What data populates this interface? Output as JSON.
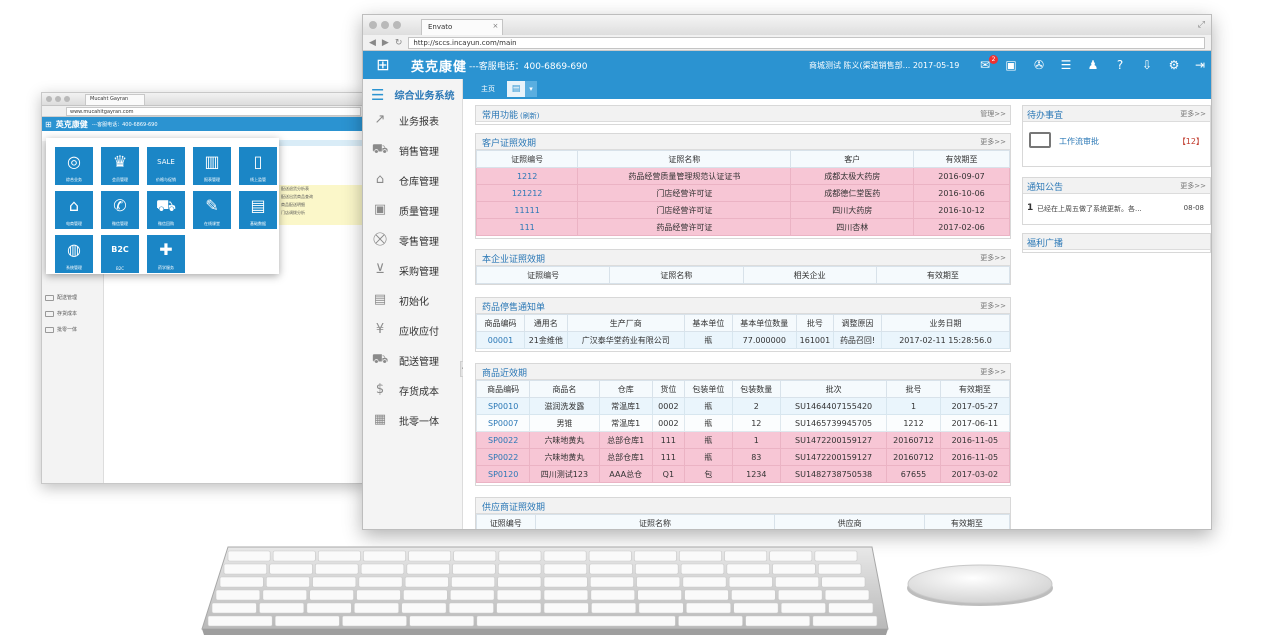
{
  "back_window": {
    "tab_title": "Mucaht Gayran",
    "url": "www.mucahitgayran.com",
    "logo": "英克康健",
    "phone": "---客服电话：400-6869-690",
    "sidebar": [
      "配送管理",
      "存货成本",
      "批零一体"
    ],
    "yellow_rows": [
      "配送退货分析表",
      "配送出货商品查询",
      "商品配送明细",
      "门店调拨分析"
    ],
    "tiles": [
      {
        "label": "综合业务",
        "icon": "globe-icon",
        "glyph": "◎"
      },
      {
        "label": "会员管理",
        "icon": "crown-icon",
        "glyph": "♛"
      },
      {
        "label": "价格与促销",
        "icon": "sale-icon",
        "glyph": "SALE"
      },
      {
        "label": "报表管理",
        "icon": "bar-chart-icon",
        "glyph": "▥"
      },
      {
        "label": "线上监管",
        "icon": "mobile-icon",
        "glyph": "▯"
      },
      {
        "label": "电商管理",
        "icon": "shop-icon",
        "glyph": "⌂"
      },
      {
        "label": "微信管理",
        "icon": "phone-chat-icon",
        "glyph": "✆"
      },
      {
        "label": "微信回购",
        "icon": "cart-icon",
        "glyph": "⛟"
      },
      {
        "label": "在线课堂",
        "icon": "graduation-cap-icon",
        "glyph": "✎"
      },
      {
        "label": "基础数据",
        "icon": "document-icon",
        "glyph": "▤"
      },
      {
        "label": "系统管理",
        "icon": "globe-icon",
        "glyph": "◍"
      },
      {
        "label": "B2C",
        "icon": "b2c-icon",
        "glyph": "B2C"
      },
      {
        "label": "药学服务",
        "icon": "medical-kit-icon",
        "glyph": "✚"
      }
    ]
  },
  "front_window": {
    "tab_title": "Envato",
    "url": "http://sccs.incayun.com/main",
    "app": {
      "logo": "英克康健",
      "phone": "---客服电话：400-6869-690",
      "user_info": "商城测试  陈义(渠道销售部...   2017-05-19",
      "message_badge": "2"
    },
    "toolbar_icons": [
      "message-icon",
      "qr-code-icon",
      "globe-icon",
      "list-icon",
      "user-tree-icon",
      "help-icon",
      "download-icon",
      "gear-icon",
      "logout-icon"
    ],
    "sidebar": {
      "title": "综合业务系统",
      "items": [
        {
          "label": "业务报表",
          "icon": "chart-icon",
          "glyph": "↗"
        },
        {
          "label": "销售管理",
          "icon": "truck-icon",
          "glyph": "⛟"
        },
        {
          "label": "仓库管理",
          "icon": "warehouse-icon",
          "glyph": "⌂"
        },
        {
          "label": "质量管理",
          "icon": "quality-box-icon",
          "glyph": "▣"
        },
        {
          "label": "零售管理",
          "icon": "cart-icon",
          "glyph": "⛒"
        },
        {
          "label": "采购管理",
          "icon": "basket-icon",
          "glyph": "⊻"
        },
        {
          "label": "初始化",
          "icon": "init-icon",
          "glyph": "▤"
        },
        {
          "label": "应收应付",
          "icon": "hand-money-icon",
          "glyph": "¥"
        },
        {
          "label": "配送管理",
          "icon": "van-icon",
          "glyph": "⛟"
        },
        {
          "label": "存货成本",
          "icon": "money-bag-icon",
          "glyph": "$"
        },
        {
          "label": "批零一体",
          "icon": "pos-icon",
          "glyph": "▦"
        }
      ]
    },
    "tabs": {
      "home": "主页"
    },
    "panels": {
      "common": {
        "title": "常用功能",
        "refresh": "(刷新)",
        "action": "管理>>"
      },
      "customer_license": {
        "title": "客户证照效期",
        "more": "更多>>",
        "headers": [
          "证照编号",
          "证照名称",
          "客户",
          "有效期至"
        ],
        "rows": [
          [
            "1212",
            "药品经营质量管理规范认证证书",
            "成都太极大药房",
            "2016-09-07"
          ],
          [
            "121212",
            "门店经营许可证",
            "成都德仁堂医药",
            "2016-10-06"
          ],
          [
            "11111",
            "门店经营许可证",
            "四川大药房",
            "2016-10-12"
          ],
          [
            "111",
            "药品经营许可证",
            "四川杏林",
            "2017-02-06"
          ]
        ]
      },
      "company_license": {
        "title": "本企业证照效期",
        "more": "更多>>",
        "headers": [
          "证照编号",
          "证照名称",
          "相关企业",
          "有效期至"
        ]
      },
      "drug_stop": {
        "title": "药品停售通知单",
        "more": "更多>>",
        "headers": [
          "商品编码",
          "通用名",
          "生产厂商",
          "基本单位",
          "基本单位数量",
          "批号",
          "调整原因",
          "业务日期"
        ],
        "rows": [
          [
            "00001",
            "21金维他",
            "广汉泰华堂药业有限公司",
            "瓶",
            "77.000000",
            "161001",
            "药品召回!",
            "2017-02-11 15:28:56.0"
          ]
        ]
      },
      "near_expiry": {
        "title": "商品近效期",
        "more": "更多>>",
        "headers": [
          "商品编码",
          "商品名",
          "仓库",
          "货位",
          "包装单位",
          "包装数量",
          "批次",
          "批号",
          "有效期至"
        ],
        "rows": [
          [
            "SP0010",
            "滋润洗发露",
            "常温库1",
            "0002",
            "瓶",
            "2",
            "SU1464407155420",
            "1",
            "2017-05-27"
          ],
          [
            "SP0007",
            "男锥",
            "常温库1",
            "0002",
            "瓶",
            "12",
            "SU1465739945705",
            "1212",
            "2017-06-11"
          ],
          [
            "SP0022",
            "六味地黄丸",
            "总部仓库1",
            "111",
            "瓶",
            "1",
            "SU1472200159127",
            "20160712",
            "2016-11-05"
          ],
          [
            "SP0022",
            "六味地黄丸",
            "总部仓库1",
            "111",
            "瓶",
            "83",
            "SU1472200159127",
            "20160712",
            "2016-11-05"
          ],
          [
            "SP0120",
            "四川测试123",
            "AAA总仓",
            "Q1",
            "包",
            "1234",
            "SU1482738750538",
            "67655",
            "2017-03-02"
          ]
        ]
      },
      "supplier_license": {
        "title": "供应商证照效期",
        "headers": [
          "证照编号",
          "证照名称",
          "供应商",
          "有效期至"
        ]
      }
    },
    "right": {
      "todo": {
        "title": "待办事宜",
        "more": "更多>>",
        "item": "工作流审批",
        "count": "【12】"
      },
      "notice": {
        "title": "通知公告",
        "more": "更多>>",
        "index": "1",
        "text": "已经在上周五做了系统更新。各...",
        "date": "08-08"
      },
      "welfare": {
        "title": "福利广播"
      }
    }
  },
  "colors": {
    "brand_blue": "#2b93d1",
    "row_pink": "#f7c6d5",
    "row_blue": "#eaf5fc"
  }
}
